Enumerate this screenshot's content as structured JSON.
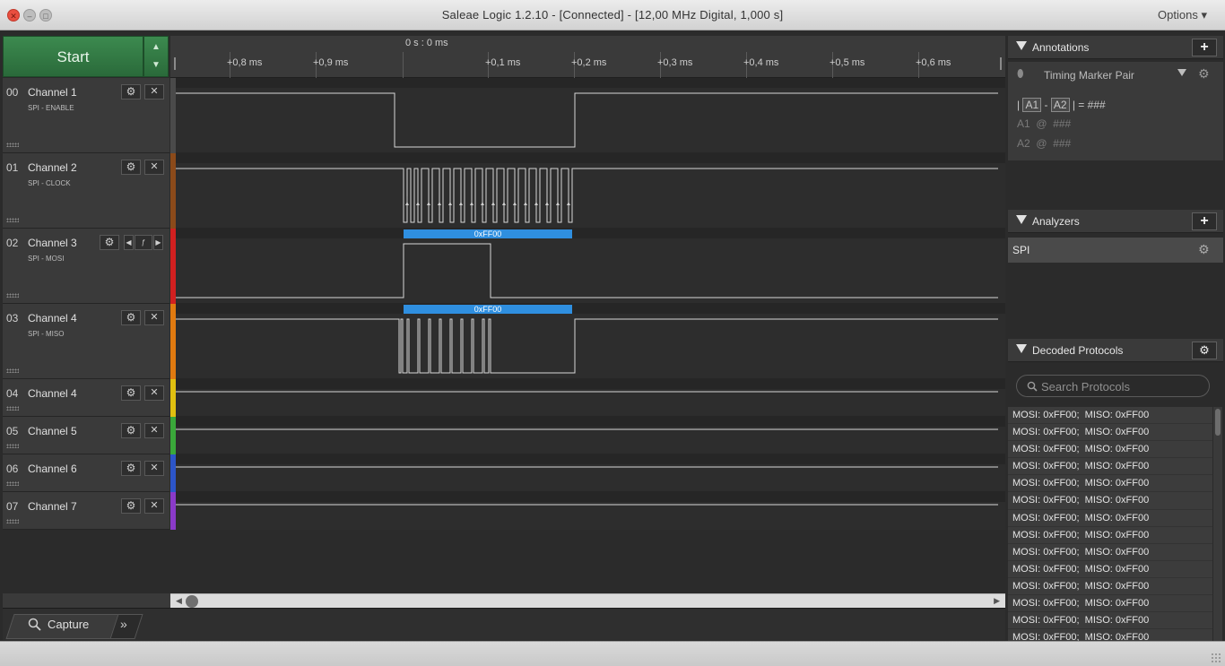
{
  "window": {
    "title": "Saleae Logic 1.2.10 - [Connected] - [12,00 MHz Digital, 1,000 s]",
    "options_label": "Options ▾"
  },
  "controls": {
    "start_label": "Start"
  },
  "timeline": {
    "origin_label": "0 s : 0 ms",
    "ticks": [
      "+0,8 ms",
      "+0,9 ms",
      "+0,1 ms",
      "+0,2 ms",
      "+0,3 ms",
      "+0,4 ms",
      "+0,5 ms",
      "+0,6 ms"
    ]
  },
  "channels": [
    {
      "num": "00",
      "name": "Channel 1",
      "sub": "SPI - ENABLE",
      "color": "#4a4a4a"
    },
    {
      "num": "01",
      "name": "Channel 2",
      "sub": "SPI - CLOCK",
      "color": "#8b4a1a"
    },
    {
      "num": "02",
      "name": "Channel 3",
      "sub": "SPI - MOSI",
      "color": "#d12020"
    },
    {
      "num": "03",
      "name": "Channel 4",
      "sub": "SPI - MISO",
      "color": "#e07a10"
    },
    {
      "num": "04",
      "name": "Channel 4",
      "sub": "",
      "color": "#e0c010"
    },
    {
      "num": "05",
      "name": "Channel 5",
      "sub": "",
      "color": "#3aa83a"
    },
    {
      "num": "06",
      "name": "Channel 6",
      "sub": "",
      "color": "#2c55c8"
    },
    {
      "num": "07",
      "name": "Channel 7",
      "sub": "",
      "color": "#8a3ac8"
    }
  ],
  "protocol_bubbles": {
    "mosi": "0xFF00",
    "miso": "0xFF00"
  },
  "tabs": {
    "capture_label": "Capture",
    "more_label": "»"
  },
  "annotations": {
    "header": "Annotations",
    "marker_pair_label": "Timing Marker Pair",
    "line1_a1": "A1",
    "line1_a2": "A2",
    "line1_sep": "-",
    "line1_result": "| = ###",
    "line2": "A1  @  ###",
    "line3": "A2  @  ###"
  },
  "analyzers": {
    "header": "Analyzers",
    "items": [
      "SPI"
    ]
  },
  "decoded": {
    "header": "Decoded Protocols",
    "search_placeholder": "Search Protocols",
    "rows": [
      "MOSI: 0xFF00;  MISO: 0xFF00",
      "MOSI: 0xFF00;  MISO: 0xFF00",
      "MOSI: 0xFF00;  MISO: 0xFF00",
      "MOSI: 0xFF00;  MISO: 0xFF00",
      "MOSI: 0xFF00;  MISO: 0xFF00",
      "MOSI: 0xFF00;  MISO: 0xFF00",
      "MOSI: 0xFF00;  MISO: 0xFF00",
      "MOSI: 0xFF00;  MISO: 0xFF00",
      "MOSI: 0xFF00;  MISO: 0xFF00",
      "MOSI: 0xFF00;  MISO: 0xFF00",
      "MOSI: 0xFF00;  MISO: 0xFF00",
      "MOSI: 0xFF00;  MISO: 0xFF00",
      "MOSI: 0xFF00;  MISO: 0xFF00",
      "MOSI: 0xFF00;  MISO: 0xFF00"
    ]
  }
}
